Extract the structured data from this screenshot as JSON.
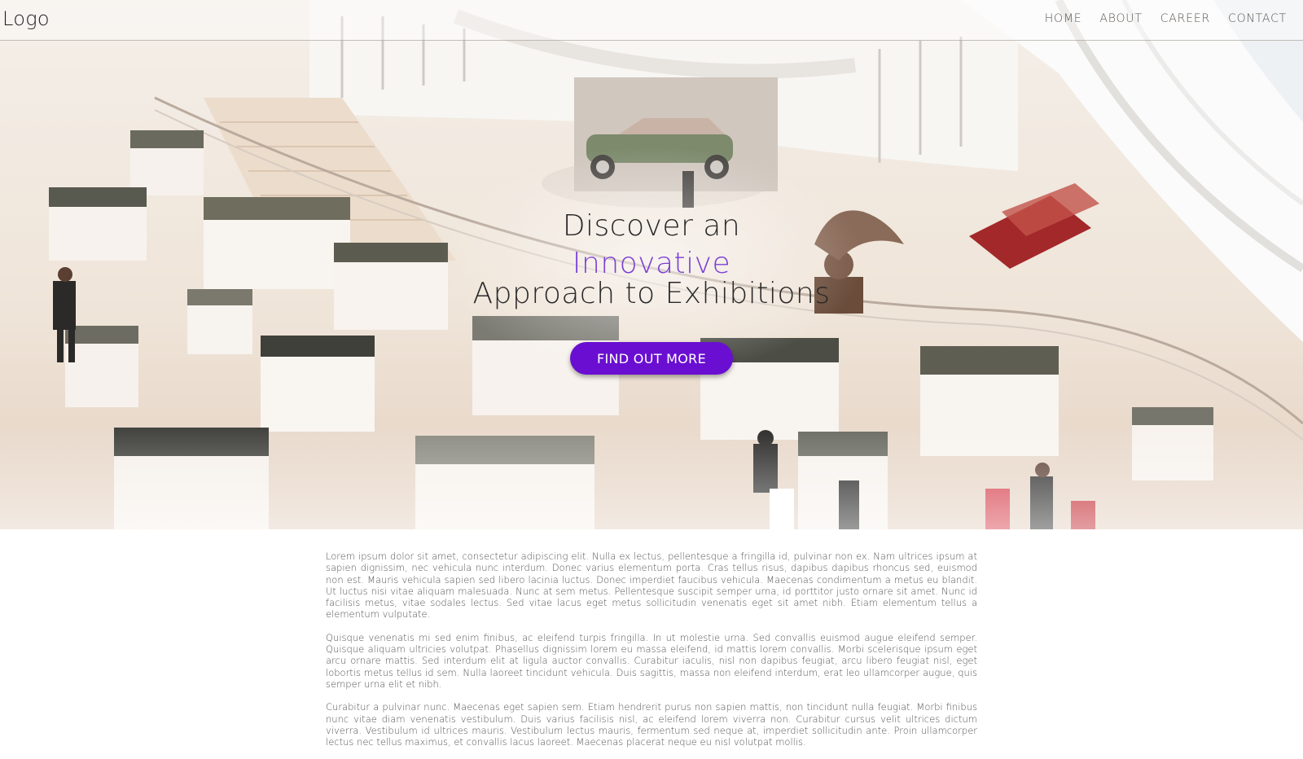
{
  "nav": {
    "logo": "Logo",
    "links": [
      "HOME",
      "ABOUT",
      "CAREER",
      "CONTACT"
    ]
  },
  "hero": {
    "line1": "Discover an",
    "line2": "Innovative",
    "line3": "Approach to Exhibitions",
    "cta_label": "FIND OUT MORE",
    "accent_color": "#7b3fd4",
    "button_color": "#6a0fd1"
  },
  "body": {
    "paragraphs": [
      "Lorem ipsum dolor sit amet, consectetur adipiscing elit. Nulla ex lectus, pellentesque a fringilla id, pulvinar non ex. Nam ultrices ipsum at sapien dignissim, nec vehicula nunc interdum. Donec varius elementum porta. Cras tellus risus, dapibus dapibus rhoncus sed, euismod non est. Mauris vehicula sapien sed libero lacinia luctus. Donec imperdiet faucibus vehicula. Maecenas condimentum a metus eu blandit. Ut luctus nisi vitae aliquam malesuada. Nunc at sem metus. Pellentesque suscipit semper urna, id porttitor justo ornare sit amet. Nunc id facilisis metus, vitae sodales lectus. Sed vitae lacus eget metus sollicitudin venenatis eget sit amet nibh. Etiam elementum tellus a elementum vulputate.",
      "Quisque venenatis mi sed enim finibus, ac eleifend turpis fringilla. In ut molestie urna. Sed convallis euismod augue eleifend semper. Quisque aliquam ultricies volutpat. Phasellus dignissim lorem eu massa eleifend, id mattis lorem convallis. Morbi scelerisque ipsum eget arcu ornare mattis. Sed interdum elit at ligula auctor convallis. Curabitur iaculis, nisl non dapibus feugiat, arcu libero feugiat nisl, eget lobortis metus tellus id sem. Nulla laoreet tincidunt vehicula. Duis sagittis, massa non eleifend interdum, erat leo ullamcorper augue, quis semper urna elit et nibh.",
      "Curabitur a pulvinar nunc. Maecenas eget sapien sem. Etiam hendrerit purus non sapien mattis, non tincidunt nulla feugiat. Morbi finibus nunc vitae diam venenatis vestibulum. Duis varius facilisis nisl, ac eleifend lorem viverra non. Curabitur cursus velit ultrices dictum viverra. Vestibulum id ultrices mauris. Vestibulum lectus mauris, fermentum sed neque at, imperdiet sollicitudin ante. Proin ullamcorper lectus nec tellus maximus, et convallis lacus laoreet. Maecenas placerat neque eu nisl volutpat mollis."
    ]
  }
}
